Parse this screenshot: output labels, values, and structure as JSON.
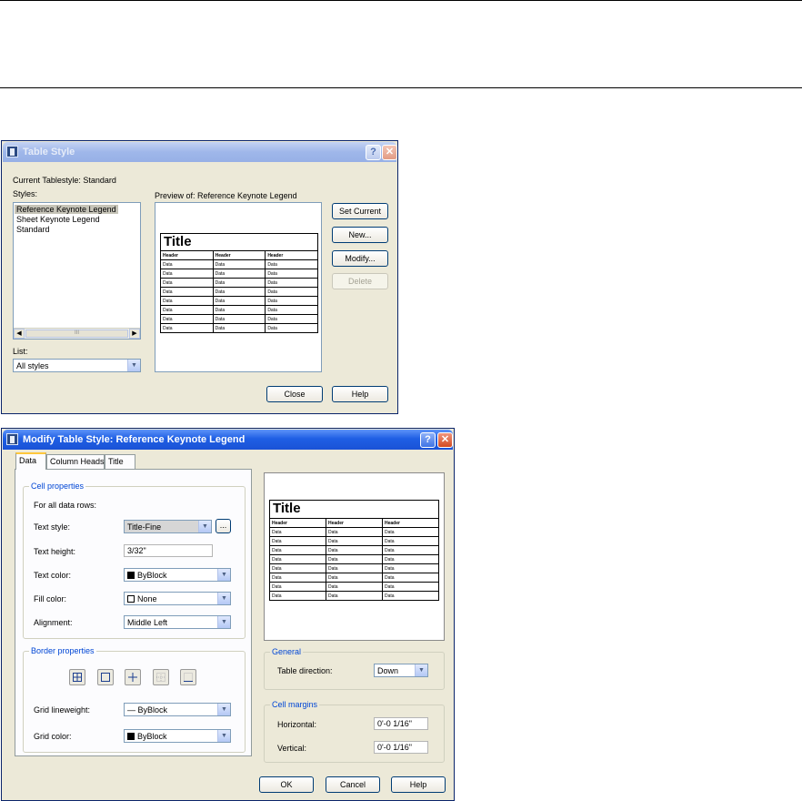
{
  "table_style_dialog": {
    "title": "Table Style",
    "current_tablestyle": "Current Tablestyle: Standard",
    "styles_label": "Styles:",
    "styles": [
      "Reference Keynote Legend",
      "Sheet Keynote Legend",
      "Standard"
    ],
    "preview_label": "Preview of: Reference Keynote Legend",
    "list_label": "List:",
    "list_value": "All styles",
    "buttons": {
      "set_current": "Set Current",
      "new": "New...",
      "modify": "Modify...",
      "delete": "Delete",
      "close": "Close",
      "help": "Help"
    }
  },
  "preview": {
    "title": "Title",
    "headers": [
      "Header",
      "Header",
      "Header"
    ],
    "cell": "Data"
  },
  "modify_dialog": {
    "title": "Modify Table Style: Reference Keynote Legend",
    "tabs": [
      "Data",
      "Column Heads",
      "Title"
    ],
    "cell_properties": {
      "legend": "Cell properties",
      "subtitle": "For all data rows:",
      "text_style_label": "Text style:",
      "text_style_value": "Title-Fine",
      "text_style_button": "...",
      "text_height_label": "Text height:",
      "text_height_value": "3/32\"",
      "text_color_label": "Text color:",
      "text_color_value": "ByBlock",
      "fill_color_label": "Fill color:",
      "fill_color_value": "None",
      "alignment_label": "Alignment:",
      "alignment_value": "Middle Left"
    },
    "border_properties": {
      "legend": "Border properties",
      "grid_lineweight_label": "Grid lineweight:",
      "grid_lineweight_value": "ByBlock",
      "grid_color_label": "Grid color:",
      "grid_color_value": "ByBlock"
    },
    "general": {
      "legend": "General",
      "table_direction_label": "Table direction:",
      "table_direction_value": "Down"
    },
    "cell_margins": {
      "legend": "Cell margins",
      "horizontal_label": "Horizontal:",
      "horizontal_value": "0'-0 1/16\"",
      "vertical_label": "Vertical:",
      "vertical_value": "0'-0 1/16\""
    },
    "buttons": {
      "ok": "OK",
      "cancel": "Cancel",
      "help": "Help"
    }
  },
  "icons": [
    "app-icon",
    "help-icon",
    "close-icon",
    "chevron-down-icon",
    "scroll-left-icon",
    "scroll-right-icon"
  ],
  "colors": {
    "titlebar_active": "#1f5fe4",
    "titlebar_inactive": "#9fb7ea",
    "dialog_bg": "#ece9d8",
    "group_legend": "#0046d5",
    "close_button": "#d34a22"
  }
}
